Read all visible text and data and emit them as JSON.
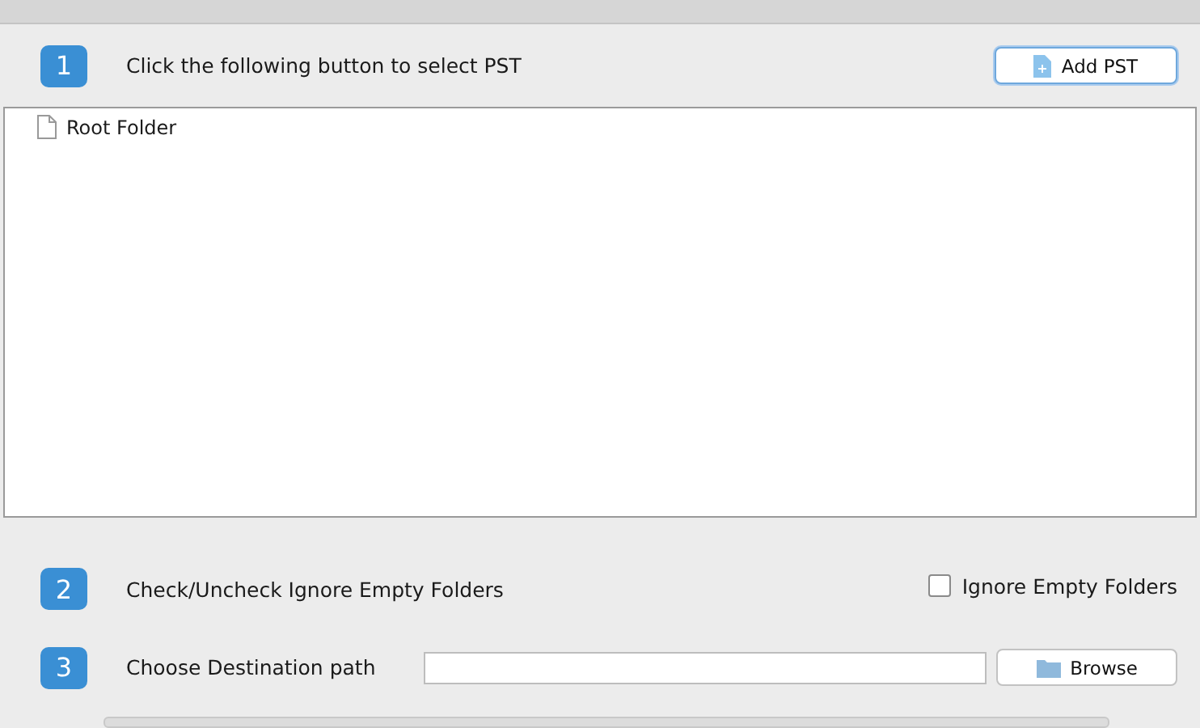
{
  "steps": [
    {
      "number": "1",
      "label": "Click the following button to select PST",
      "kind": "button",
      "button": "Add PST"
    },
    {
      "number": "2",
      "label": "Check/Uncheck Ignore Empty Folders",
      "kind": "checkbox",
      "checkbox": {
        "label": "Ignore Empty Folders",
        "checked": false
      }
    },
    {
      "number": "3",
      "label": "Choose Destination path",
      "kind": "path",
      "button": "Browse"
    }
  ],
  "tree": {
    "items": [
      {
        "label": "Root Folder"
      }
    ]
  }
}
